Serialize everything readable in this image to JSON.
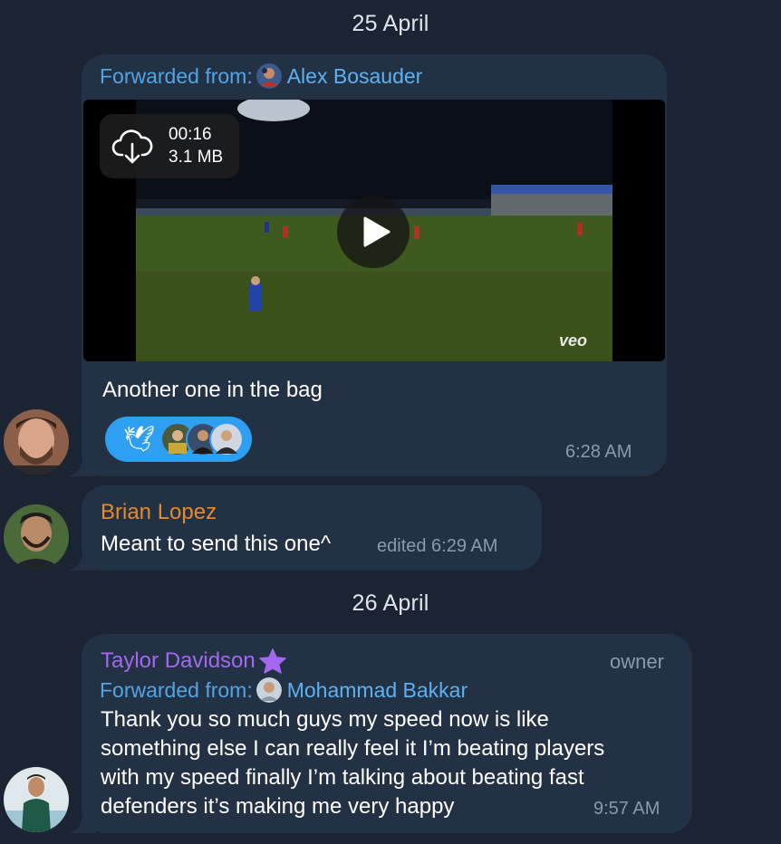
{
  "dates": [
    "25 April",
    "26 April"
  ],
  "messages": [
    {
      "forwarded_label": "Forwarded from:",
      "forwarded_name": "Alex Bosauder",
      "video": {
        "duration": "00:16",
        "size": "3.1 MB",
        "watermark": "veo"
      },
      "text": "Another one in the bag",
      "reaction_emoji": "🕊",
      "time": "6:28 AM"
    },
    {
      "sender": "Brian Lopez",
      "text": "Meant to send this one^",
      "time": "edited 6:29 AM"
    },
    {
      "sender": "Taylor Davidson",
      "role": "owner",
      "forwarded_label": "Forwarded from:",
      "forwarded_name": "Mohammad Bakkar",
      "text_lines": [
        "Thank you so much guys my speed now is like",
        "something else I can really feel it I’m beating players",
        "with my speed finally I’m talking about beating fast",
        "defenders it’s making me very happy"
      ],
      "time": "9:57 AM"
    }
  ],
  "colors": {
    "background": "#1a2432",
    "bubble": "#223244",
    "link_blue": "#54a3e5",
    "brian_orange": "#e38a2e",
    "taylor_purple": "#a468f0",
    "reaction_blue": "#2f9ff2"
  },
  "icons": [
    "cloud-download-icon",
    "play-icon",
    "star-icon"
  ]
}
